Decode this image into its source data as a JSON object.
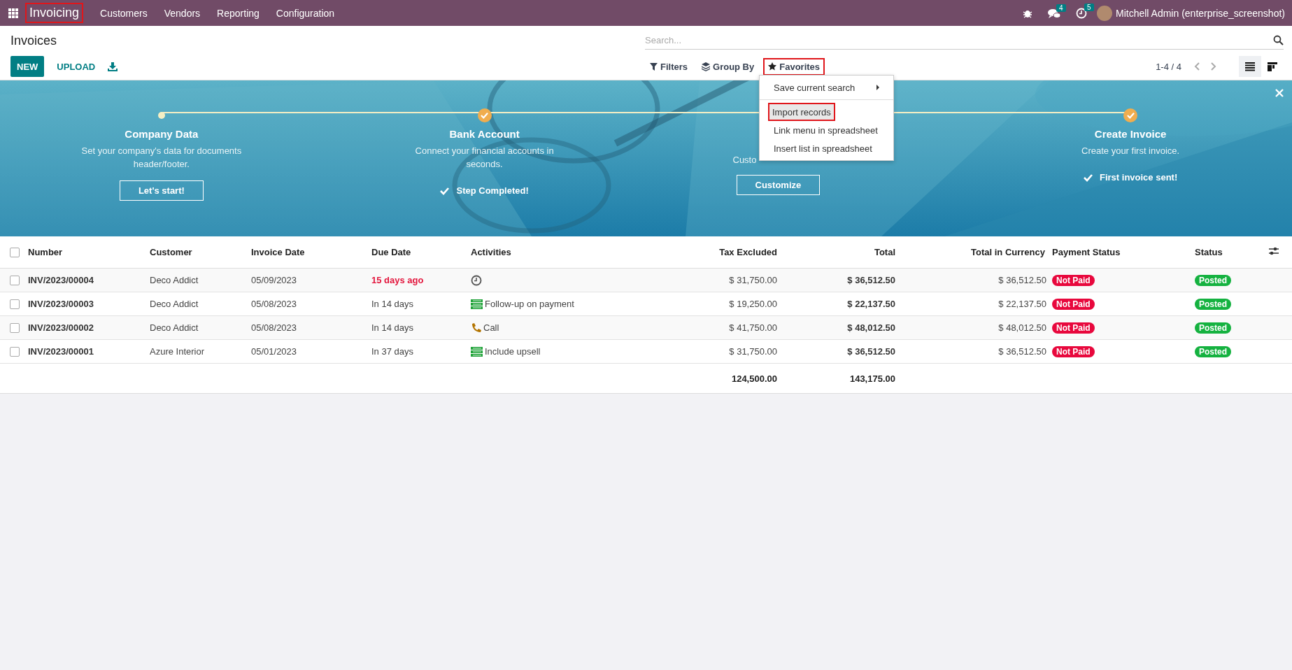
{
  "navbar": {
    "app": {
      "label": "Invoicing",
      "highlighted": true
    },
    "menus": [
      "Customers",
      "Vendors",
      "Reporting",
      "Configuration"
    ],
    "messages_count": "4",
    "activities_count": "5",
    "user": "Mitchell Admin (enterprise_screenshot)"
  },
  "control_panel": {
    "title": "Invoices",
    "buttons": [
      {
        "label": "NEW",
        "kind": "primary"
      },
      {
        "label": "UPLOAD",
        "kind": "link"
      }
    ],
    "search": {
      "placeholder": "Search..."
    },
    "filters": [
      {
        "label": "Filters",
        "kind": "filter",
        "highlighted": false
      },
      {
        "label": "Group By",
        "kind": "group",
        "highlighted": false
      },
      {
        "label": "Favorites",
        "kind": "star",
        "highlighted": true
      }
    ],
    "pager": "1-4 / 4",
    "views": [
      {
        "kind": "list",
        "selected": true
      },
      {
        "kind": "kanban",
        "selected": false
      }
    ]
  },
  "favorites_menu": {
    "items": [
      {
        "label": "Save current search",
        "kind": "submenu",
        "hovered": false,
        "highlighted": false
      },
      {
        "label": "Import records",
        "kind": "action",
        "hovered": true,
        "highlighted": true
      },
      {
        "label": "Link menu in spreadsheet",
        "kind": "action",
        "hovered": false,
        "highlighted": false
      },
      {
        "label": "Insert list in spreadsheet",
        "kind": "action",
        "hovered": false,
        "highlighted": false
      }
    ]
  },
  "banner": {
    "steps": [
      {
        "kind": "step",
        "title": "Company Data",
        "description": "Set your company's data for documents header/footer.",
        "done": false,
        "action": "Let's start!"
      },
      {
        "kind": "step",
        "title": "Bank Account",
        "description": "Connect your financial accounts in seconds.",
        "done": true,
        "action": "Step Completed!"
      },
      {
        "kind": "partly_hidden",
        "description": "Custo",
        "done": false,
        "action": "Customize"
      },
      {
        "kind": "step",
        "title": "Create Invoice",
        "description": "Create your first invoice.",
        "done": true,
        "action": "First invoice sent!"
      }
    ]
  },
  "list": {
    "select_all_checked": false,
    "columns": [
      "Number",
      "Customer",
      "Invoice Date",
      "Due Date",
      "Activities",
      "Tax Excluded",
      "Total",
      "Total in Currency",
      "Payment Status",
      "Status"
    ],
    "rows": [
      {
        "checked": false,
        "number": "INV/2023/00004",
        "customer": "Deco Addict",
        "invoice_date": "05/09/2023",
        "due_date": "15 days ago",
        "overdue": true,
        "activity": {
          "kind": "clock"
        },
        "tax_excluded": "$ 31,750.00",
        "total": "$ 36,512.50",
        "total_currency": "$ 36,512.50",
        "payment_status": "Not Paid",
        "status": "Posted"
      },
      {
        "checked": false,
        "number": "INV/2023/00003",
        "customer": "Deco Addict",
        "invoice_date": "05/08/2023",
        "due_date": "In 14 days",
        "overdue": false,
        "activity": {
          "kind": "todo",
          "label": "Follow-up on payment"
        },
        "tax_excluded": "$ 19,250.00",
        "total": "$ 22,137.50",
        "total_currency": "$ 22,137.50",
        "payment_status": "Not Paid",
        "status": "Posted"
      },
      {
        "checked": false,
        "number": "INV/2023/00002",
        "customer": "Deco Addict",
        "invoice_date": "05/08/2023",
        "due_date": "In 14 days",
        "overdue": false,
        "activity": {
          "kind": "call",
          "label": "Call"
        },
        "tax_excluded": "$ 41,750.00",
        "total": "$ 48,012.50",
        "total_currency": "$ 48,012.50",
        "payment_status": "Not Paid",
        "status": "Posted"
      },
      {
        "checked": false,
        "number": "INV/2023/00001",
        "customer": "Azure Interior",
        "invoice_date": "05/01/2023",
        "due_date": "In 37 days",
        "overdue": false,
        "activity": {
          "kind": "todo",
          "label": "Include upsell"
        },
        "tax_excluded": "$ 31,750.00",
        "total": "$ 36,512.50",
        "total_currency": "$ 36,512.50",
        "payment_status": "Not Paid",
        "status": "Posted"
      }
    ],
    "totals": {
      "tax_excluded": "124,500.00",
      "total": "143,175.00"
    }
  }
}
